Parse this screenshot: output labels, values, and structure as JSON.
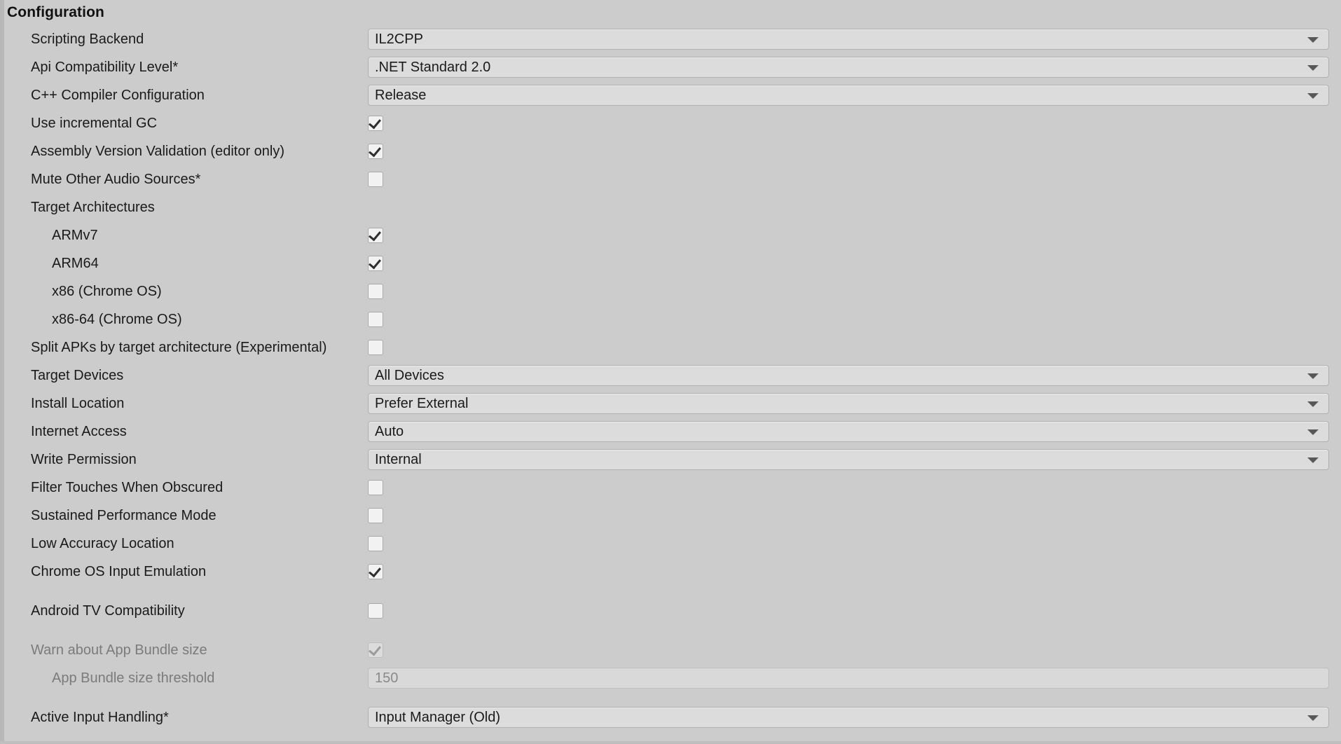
{
  "section": {
    "title": "Configuration"
  },
  "colors": {
    "background": "#cccccc",
    "field": "#dcdcdc",
    "field_border": "#b0b0b0",
    "text": "#1a1a1a",
    "text_disabled": "#7b7b7b",
    "checkbox_fill": "#f2f2f2",
    "arrow": "#585858"
  },
  "rows": [
    {
      "label": "Scripting Backend",
      "type": "dropdown",
      "value": "IL2CPP",
      "indent": 1,
      "disabled": false,
      "name": "scripting-backend"
    },
    {
      "label": "Api Compatibility Level*",
      "type": "dropdown",
      "value": ".NET Standard 2.0",
      "indent": 1,
      "disabled": false,
      "name": "api-compatibility-level"
    },
    {
      "label": "C++ Compiler Configuration",
      "type": "dropdown",
      "value": "Release",
      "indent": 1,
      "disabled": false,
      "name": "cpp-compiler-configuration"
    },
    {
      "label": "Use incremental GC",
      "type": "checkbox",
      "checked": true,
      "indent": 1,
      "disabled": false,
      "name": "use-incremental-gc"
    },
    {
      "label": "Assembly Version Validation (editor only)",
      "type": "checkbox",
      "checked": true,
      "indent": 1,
      "disabled": false,
      "name": "assembly-version-validation"
    },
    {
      "label": "Mute Other Audio Sources*",
      "type": "checkbox",
      "checked": false,
      "indent": 1,
      "disabled": false,
      "name": "mute-other-audio-sources"
    },
    {
      "label": "Target Architectures",
      "type": "header",
      "indent": 1,
      "disabled": false,
      "name": "target-architectures"
    },
    {
      "label": "ARMv7",
      "type": "checkbox",
      "checked": true,
      "indent": 2,
      "disabled": false,
      "name": "armv7"
    },
    {
      "label": "ARM64",
      "type": "checkbox",
      "checked": true,
      "indent": 2,
      "disabled": false,
      "name": "arm64"
    },
    {
      "label": "x86 (Chrome OS)",
      "type": "checkbox",
      "checked": false,
      "indent": 2,
      "disabled": false,
      "name": "x86-chrome-os"
    },
    {
      "label": "x86-64 (Chrome OS)",
      "type": "checkbox",
      "checked": false,
      "indent": 2,
      "disabled": false,
      "name": "x86-64-chrome-os"
    },
    {
      "label": "Split APKs by target architecture (Experimental)",
      "type": "checkbox",
      "checked": false,
      "indent": 1,
      "disabled": false,
      "name": "split-apks-by-target-architecture"
    },
    {
      "label": "Target Devices",
      "type": "dropdown",
      "value": "All Devices",
      "indent": 1,
      "disabled": false,
      "name": "target-devices"
    },
    {
      "label": "Install Location",
      "type": "dropdown",
      "value": "Prefer External",
      "indent": 1,
      "disabled": false,
      "name": "install-location"
    },
    {
      "label": "Internet Access",
      "type": "dropdown",
      "value": "Auto",
      "indent": 1,
      "disabled": false,
      "name": "internet-access"
    },
    {
      "label": "Write Permission",
      "type": "dropdown",
      "value": "Internal",
      "indent": 1,
      "disabled": false,
      "name": "write-permission"
    },
    {
      "label": "Filter Touches When Obscured",
      "type": "checkbox",
      "checked": false,
      "indent": 1,
      "disabled": false,
      "name": "filter-touches-when-obscured"
    },
    {
      "label": "Sustained Performance Mode",
      "type": "checkbox",
      "checked": false,
      "indent": 1,
      "disabled": false,
      "name": "sustained-performance-mode"
    },
    {
      "label": "Low Accuracy Location",
      "type": "checkbox",
      "checked": false,
      "indent": 1,
      "disabled": false,
      "name": "low-accuracy-location"
    },
    {
      "label": "Chrome OS Input Emulation",
      "type": "checkbox",
      "checked": true,
      "indent": 1,
      "disabled": false,
      "name": "chrome-os-input-emulation"
    },
    {
      "label": "Android TV Compatibility",
      "type": "checkbox",
      "checked": false,
      "indent": 1,
      "disabled": false,
      "gap_before": true,
      "name": "android-tv-compatibility"
    },
    {
      "label": "Warn about App Bundle size",
      "type": "checkbox",
      "checked": true,
      "indent": 1,
      "disabled": true,
      "gap_before": true,
      "name": "warn-about-app-bundle-size"
    },
    {
      "label": "App Bundle size threshold",
      "type": "textfield",
      "value": "150",
      "indent": 2,
      "disabled": true,
      "name": "app-bundle-size-threshold"
    },
    {
      "label": "Active Input Handling*",
      "type": "dropdown",
      "value": "Input Manager (Old)",
      "indent": 1,
      "disabled": false,
      "gap_before": true,
      "name": "active-input-handling"
    }
  ]
}
